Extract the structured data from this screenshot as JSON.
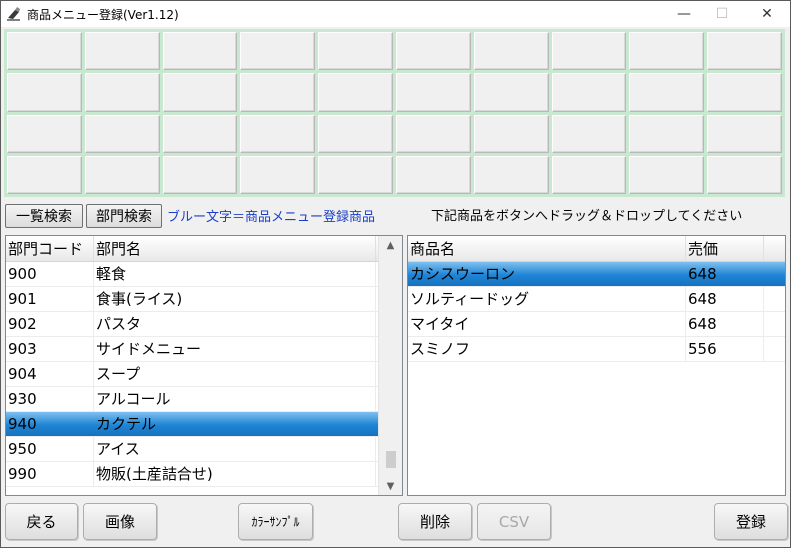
{
  "window": {
    "title": "商品メニュー登録(Ver1.12)",
    "minimize_glyph": "—",
    "maximize_glyph": "☐",
    "close_glyph": "✕"
  },
  "toolbar": {
    "list_search_label": "一覧検索",
    "dept_search_label": "部門検索",
    "blue_note": "ブルー文字＝商品メニュー登録商品",
    "drag_note": "下記商品をボタンへドラッグ＆ドロップしてください"
  },
  "departments": {
    "headers": [
      "部門コード",
      "部門名"
    ],
    "rows": [
      {
        "code": "900",
        "name": "軽食"
      },
      {
        "code": "901",
        "name": "食事(ライス)"
      },
      {
        "code": "902",
        "name": "パスタ"
      },
      {
        "code": "903",
        "name": "サイドメニュー"
      },
      {
        "code": "904",
        "name": "スープ"
      },
      {
        "code": "930",
        "name": "アルコール"
      },
      {
        "code": "940",
        "name": "カクテル"
      },
      {
        "code": "950",
        "name": "アイス"
      },
      {
        "code": "990",
        "name": "物販(土産詰合せ)"
      }
    ],
    "selected_index": 6
  },
  "products": {
    "headers": [
      "商品名",
      "売価"
    ],
    "rows": [
      {
        "name": "カシスウーロン",
        "price": "648"
      },
      {
        "name": "ソルティードッグ",
        "price": "648"
      },
      {
        "name": "マイタイ",
        "price": "648"
      },
      {
        "name": "スミノフ",
        "price": "556"
      }
    ],
    "selected_index": 0
  },
  "scrollbar": {
    "up_glyph": "▲",
    "down_glyph": "▼"
  },
  "buttons": {
    "back": "戻る",
    "image": "画像",
    "color_sample": "ｶﾗｰｻﾝﾌﾟﾙ",
    "delete": "削除",
    "csv": "CSV",
    "register": "登録"
  },
  "colors": {
    "selection": "#1e84d4",
    "grid_border": "#c8e8d0",
    "note_blue": "#1a3ec8"
  }
}
